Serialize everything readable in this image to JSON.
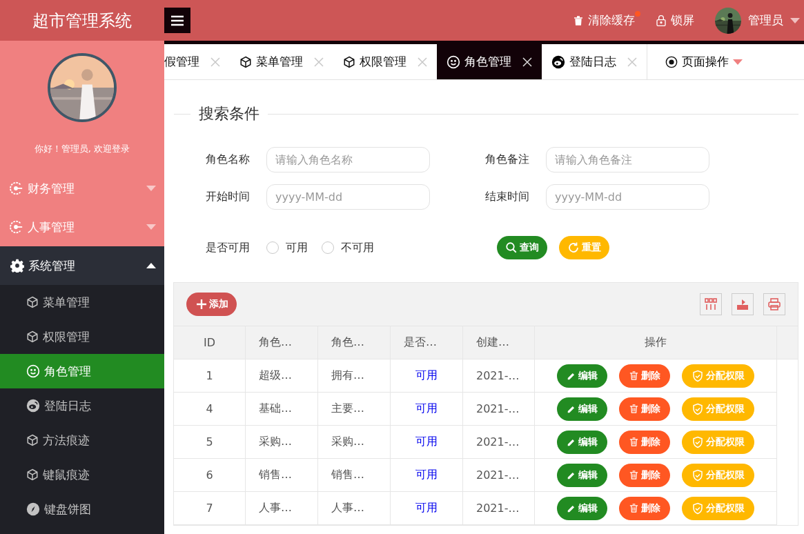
{
  "header": {
    "title": "超市管理系统",
    "actions": [
      {
        "label": "清除缓存",
        "kind": "trash",
        "badge": true
      },
      {
        "label": "锁屏",
        "kind": "lock",
        "badge": false
      }
    ],
    "user": {
      "name": "管理员"
    }
  },
  "sidebar": {
    "greeting": "你好！管理员, 欢迎登录",
    "menus": [
      {
        "label": "财务管理",
        "kind": "ring",
        "expanded": false
      },
      {
        "label": "人事管理",
        "kind": "ring",
        "expanded": false
      },
      {
        "label": "系统管理",
        "kind": "gear",
        "expanded": true,
        "children": [
          {
            "label": "菜单管理",
            "kind": "cube",
            "selected": false
          },
          {
            "label": "权限管理",
            "kind": "cube",
            "selected": false
          },
          {
            "label": "角色管理",
            "kind": "smile",
            "selected": true
          },
          {
            "label": "登陆日志",
            "kind": "weibo",
            "selected": false
          },
          {
            "label": "方法痕迹",
            "kind": "cube",
            "selected": false
          },
          {
            "label": "键鼠痕迹",
            "kind": "cube",
            "selected": false
          },
          {
            "label": "键盘饼图",
            "kind": "compass",
            "selected": false
          }
        ]
      }
    ]
  },
  "tabs": [
    {
      "label": "假管理",
      "selected": false
    },
    {
      "label": "菜单管理",
      "kind": "cube",
      "selected": false
    },
    {
      "label": "权限管理",
      "kind": "cube",
      "selected": false
    },
    {
      "label": "角色管理",
      "kind": "smile",
      "selected": true
    },
    {
      "label": "登陆日志",
      "kind": "weibo",
      "selected": false
    }
  ],
  "page_menu": {
    "label": "页面操作"
  },
  "search": {
    "title": "搜索条件",
    "fields": [
      {
        "label": "角色名称",
        "placeholder": "请输入角色名称"
      },
      {
        "label": "角色备注",
        "placeholder": "请输入角色备注"
      },
      {
        "label": "开始时间",
        "placeholder": "yyyy-MM-dd"
      },
      {
        "label": "结束时间",
        "placeholder": "yyyy-MM-dd"
      }
    ],
    "radio": {
      "label": "是否可用",
      "options": [
        {
          "label": "可用",
          "selected": false
        },
        {
          "label": "不可用",
          "selected": false
        }
      ]
    },
    "buttons": [
      {
        "label": "查询",
        "kind": "search"
      },
      {
        "label": "重置",
        "kind": "reset"
      }
    ]
  },
  "toolbar": {
    "add": "添加"
  },
  "table": {
    "columns": [
      "ID",
      "角色…",
      "角色…",
      "是否…",
      "创建…",
      "操作"
    ],
    "rows": [
      {
        "cells": [
          "1",
          "超级…",
          "拥有…",
          "可用",
          "2021-…"
        ],
        "actions": [
          "编辑",
          "删除",
          "分配权限"
        ]
      },
      {
        "cells": [
          "4",
          "基础…",
          "主要…",
          "可用",
          "2021-…"
        ],
        "actions": [
          "编辑",
          "删除",
          "分配权限"
        ]
      },
      {
        "cells": [
          "5",
          "采购…",
          "采购…",
          "可用",
          "2021-…"
        ],
        "actions": [
          "编辑",
          "删除",
          "分配权限"
        ]
      },
      {
        "cells": [
          "6",
          "销售…",
          "销售…",
          "可用",
          "2021-…"
        ],
        "actions": [
          "编辑",
          "删除",
          "分配权限"
        ]
      },
      {
        "cells": [
          "7",
          "人事…",
          "人事…",
          "可用",
          "2021-…"
        ],
        "actions": [
          "编辑",
          "删除",
          "分配权限"
        ]
      }
    ]
  }
}
